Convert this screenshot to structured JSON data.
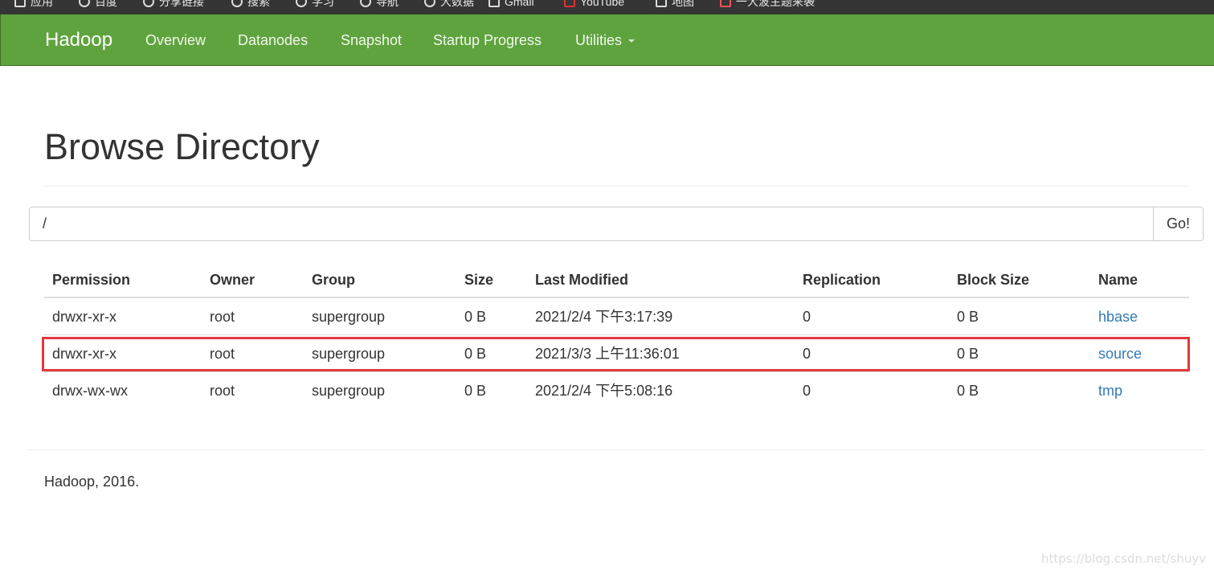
{
  "browser": {
    "bookmarks": [
      {
        "label": "应用",
        "icon": "apps-grid-icon"
      },
      {
        "label": "百度",
        "icon": "globe-icon"
      },
      {
        "label": "分享链接",
        "icon": "globe-icon"
      },
      {
        "label": "搜索",
        "icon": "globe-icon"
      },
      {
        "label": "学习",
        "icon": "globe-icon"
      },
      {
        "label": "导航",
        "icon": "globe-icon"
      },
      {
        "label": "大数据",
        "icon": "globe-icon"
      },
      {
        "label": "Gmail",
        "icon": "mail-icon"
      },
      {
        "label": "YouTube",
        "icon": "youtube-icon"
      },
      {
        "label": "地图",
        "icon": "maps-icon"
      },
      {
        "label": "一大波主题来袭",
        "icon": "bookmark-icon"
      }
    ]
  },
  "navbar": {
    "brand": "Hadoop",
    "items": [
      {
        "label": "Overview"
      },
      {
        "label": "Datanodes"
      },
      {
        "label": "Snapshot"
      },
      {
        "label": "Startup Progress"
      },
      {
        "label": "Utilities"
      }
    ],
    "color": "#5fa33e"
  },
  "page": {
    "title": "Browse Directory"
  },
  "path_bar": {
    "value": "/",
    "go_label": "Go!"
  },
  "table": {
    "headers": [
      "Permission",
      "Owner",
      "Group",
      "Size",
      "Last Modified",
      "Replication",
      "Block Size",
      "Name"
    ],
    "rows": [
      [
        "drwxr-xr-x",
        "root",
        "supergroup",
        "0 B",
        "2021/2/4 下午3:17:39",
        "0",
        "0 B",
        "hbase"
      ],
      [
        "drwxr-xr-x",
        "root",
        "supergroup",
        "0 B",
        "2021/3/3 上午11:36:01",
        "0",
        "0 B",
        "source"
      ],
      [
        "drwx-wx-wx",
        "root",
        "supergroup",
        "0 B",
        "2021/2/4 下午5:08:16",
        "0",
        "0 B",
        "tmp"
      ]
    ],
    "highlighted_row": "source",
    "highlight_color": "#e0393e",
    "link_color": "#337ab7"
  },
  "footer": {
    "text": "Hadoop, 2016."
  },
  "watermark": {
    "text": "https://blog.csdn.net/shuyv"
  }
}
